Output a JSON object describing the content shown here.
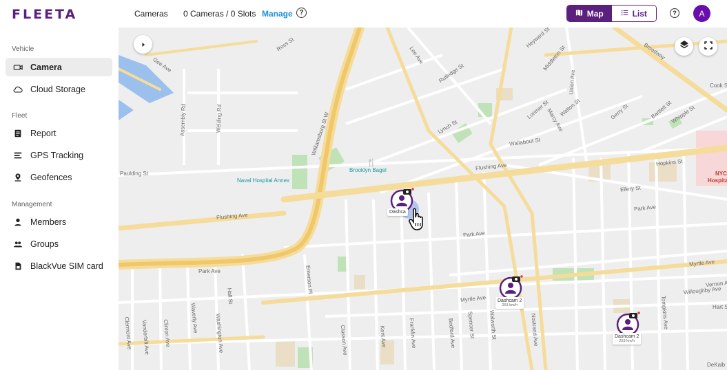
{
  "app": {
    "logo": "FLEETA"
  },
  "sidebar": {
    "sections": [
      {
        "label": "Vehicle"
      },
      {
        "label": "Fleet"
      },
      {
        "label": "Management"
      }
    ],
    "items": [
      {
        "label": "Camera",
        "icon": "camera-icon",
        "active": true
      },
      {
        "label": "Cloud Storage",
        "icon": "cloud-icon",
        "active": false
      },
      {
        "label": "Report",
        "icon": "report-icon",
        "active": false
      },
      {
        "label": "GPS Tracking",
        "icon": "gps-tracking-icon",
        "active": false
      },
      {
        "label": "Geofences",
        "icon": "geofence-icon",
        "active": false
      },
      {
        "label": "Members",
        "icon": "member-icon",
        "active": false
      },
      {
        "label": "Groups",
        "icon": "groups-icon",
        "active": false
      },
      {
        "label": "BlackVue SIM card",
        "icon": "sim-card-icon",
        "active": false
      }
    ]
  },
  "header": {
    "title": "Cameras",
    "count": "0 Cameras  /  0 Slots",
    "manage": "Manage",
    "help": "?",
    "map_label": "Map",
    "list_label": "List",
    "avatar_initial": "A"
  },
  "map": {
    "streets": [
      "Ross St",
      "Gee Ave",
      "Heyward St",
      "Lee Ave",
      "Rutledge St",
      "Middleton St",
      "Broadway",
      "Cook St",
      "Union Ave",
      "Assembly Rd",
      "Welding Rd",
      "Williamsburg St W",
      "Lynch St",
      "Lorimer St",
      "Marcy Ave",
      "Walton St",
      "Gerry St",
      "Bartlett St",
      "Whipple St",
      "Wallabout St",
      "Paulding St",
      "Flushing Ave",
      "Hopkins St",
      "Ellery St",
      "Park Ave",
      "Myrtle Ave",
      "Vernon Ave",
      "Willoughby Ave",
      "Hart St",
      "Emerson Pl",
      "Hall St",
      "Waverly Ave",
      "Washington Ave",
      "Clinton Ave",
      "Vanderbilt Ave",
      "Clermont Ave",
      "Classon Ave",
      "Kent Ave",
      "Franklin Ave",
      "Bedford Ave",
      "Spencer St",
      "Walworth St",
      "Nostrand Ave",
      "Tompkins Ave",
      "DeKalb"
    ],
    "poi_bagel": "Brooklyn Bagel",
    "poi_naval": "Naval Hospital Annex",
    "poi_nyc": "NYC",
    "poi_nyc2": "Hospita",
    "markers": [
      {
        "label": "Dashca",
        "speed": ""
      },
      {
        "label": "Dashcam 2",
        "speed": "253 km/h"
      },
      {
        "label": "Dashcam 2",
        "speed": "253 km/h"
      }
    ]
  },
  "colors": {
    "brand": "#5b1f7e",
    "accent": "#1e90d6",
    "road_major": "#f5d991",
    "water": "#8fb8ec",
    "park": "#b7dfb2"
  }
}
